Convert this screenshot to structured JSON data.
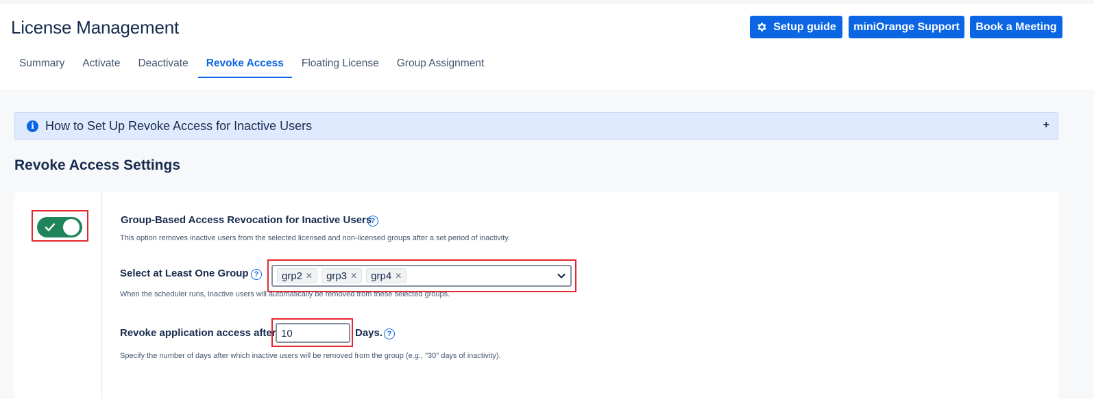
{
  "header": {
    "title": "License Management",
    "buttons": {
      "setup_guide": "Setup guide",
      "support": "miniOrange Support",
      "meeting": "Book a Meeting"
    },
    "tabs": [
      "Summary",
      "Activate",
      "Deactivate",
      "Revoke Access",
      "Floating License",
      "Group Assignment"
    ],
    "active_tab": "Revoke Access"
  },
  "info_bar": {
    "text": "How to Set Up Revoke Access for Inactive Users",
    "expand_symbol": "+"
  },
  "settings": {
    "title": "Revoke Access Settings",
    "toggle": {
      "enabled": true
    },
    "group_revocation": {
      "label": "Group-Based Access Revocation for Inactive Users",
      "description": "This option removes inactive users from the selected licensed and non-licensed groups after a set period of inactivity."
    },
    "group_select": {
      "label": "Select at Least One Group",
      "selected": [
        "grp2",
        "grp3",
        "grp4"
      ],
      "description": "When the scheduler runs, inactive users will automatically be removed from these selected groups."
    },
    "revoke_after": {
      "label_before": "Revoke application access after",
      "value": "10",
      "label_after": "Days.",
      "description": "Specify the number of days after which inactive users will be removed from the group (e.g., \"30\" days of inactivity)."
    }
  },
  "colors": {
    "primary": "#0c66e4",
    "toggle_on": "#1f845a",
    "highlight_red": "#e5262d",
    "info_bg": "#dfeafe"
  },
  "icons": {
    "setup_button": "gear-icon",
    "info_bar": "info-icon",
    "help": "question-circle-icon",
    "select": "chevron-down-icon",
    "toggle": "check-icon"
  }
}
